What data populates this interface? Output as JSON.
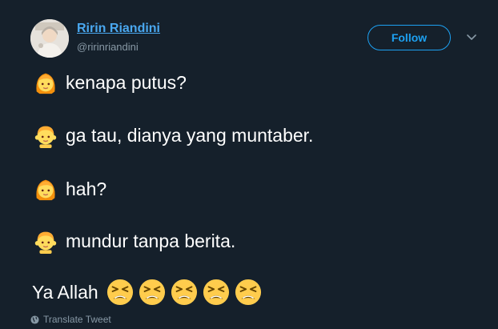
{
  "author": {
    "display_name": "Ririn Riandini",
    "handle": "@ririnriandini",
    "avatar_icon": "avatar-photo"
  },
  "follow_button": {
    "label": "Follow"
  },
  "menu": {
    "icon": "chevron-down-icon"
  },
  "tweet": {
    "lines": [
      {
        "emoji": "person-blond-hair",
        "text": "kenapa putus?"
      },
      {
        "emoji": "child",
        "text": "ga tau, dianya yang muntaber."
      },
      {
        "emoji": "person-blond-hair",
        "text": "hah?"
      },
      {
        "emoji": "child",
        "text": "mundur tanpa berita."
      }
    ],
    "closing_text": "Ya Allah",
    "closing_emoji": [
      "tired-face",
      "tired-face",
      "tired-face",
      "tired-face",
      "tired-face"
    ]
  },
  "translate": {
    "label": "Translate Tweet",
    "icon": "globe-icon"
  },
  "colors": {
    "background": "#15202b",
    "link": "#4aa8f0",
    "accent": "#1da1f2",
    "muted": "#8899a6",
    "text": "#ffffff",
    "emoji_yellow": "#ffcc4d"
  }
}
